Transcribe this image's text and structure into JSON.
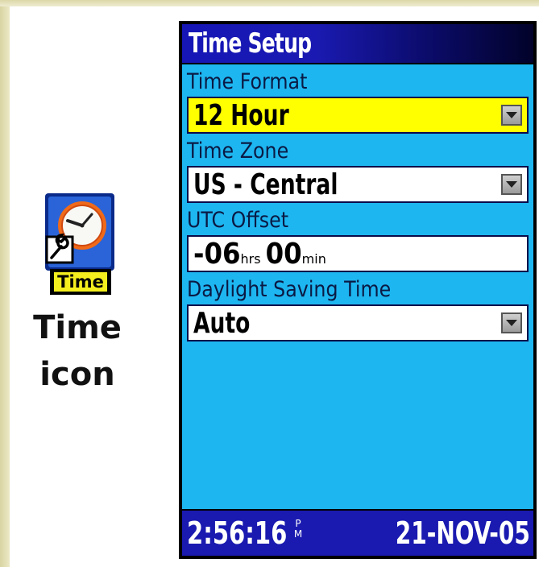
{
  "icon": {
    "label": "Time",
    "caption_line1": "Time",
    "caption_line2": "icon"
  },
  "screen": {
    "title": "Time Setup",
    "fields": {
      "time_format": {
        "label": "Time Format",
        "value": "12 Hour"
      },
      "time_zone": {
        "label": "Time Zone",
        "value": "US - Central"
      },
      "utc_offset": {
        "label": "UTC Offset",
        "hours": "-06",
        "hours_unit": "hrs",
        "minutes": "00",
        "minutes_unit": "min"
      },
      "daylight_saving": {
        "label": "Daylight Saving Time",
        "value": "Auto"
      }
    },
    "status": {
      "time": "2:56:16",
      "ampm_top": "P",
      "ampm_bottom": "M",
      "date": "21-NOV-05"
    }
  },
  "colors": {
    "screen_bg": "#1eb6f0",
    "title_bar": "#1616b6",
    "highlight": "#ffff00",
    "status_bar": "#1a1ab0"
  }
}
